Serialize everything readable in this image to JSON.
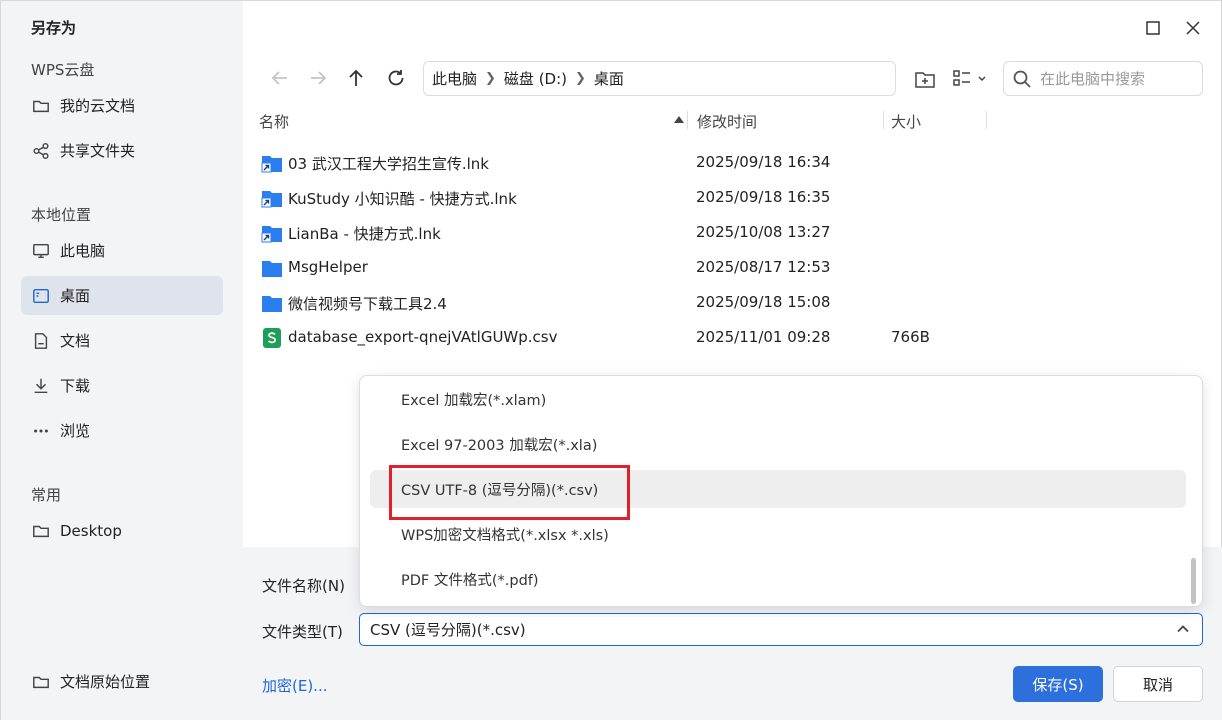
{
  "window": {
    "title": "另存为"
  },
  "sidebar": {
    "sections": [
      {
        "label": "WPS云盘"
      },
      {
        "label": "本地位置"
      },
      {
        "label": "常用"
      }
    ],
    "cloud_items": [
      {
        "label": "我的云文档",
        "icon": "folder-icon"
      },
      {
        "label": "共享文件夹",
        "icon": "share-icon"
      }
    ],
    "local_items": [
      {
        "label": "此电脑",
        "icon": "monitor-icon"
      },
      {
        "label": "桌面",
        "icon": "desktop-icon",
        "active": true
      },
      {
        "label": "文档",
        "icon": "document-icon"
      },
      {
        "label": "下载",
        "icon": "download-icon"
      },
      {
        "label": "浏览",
        "icon": "more-icon"
      }
    ],
    "common_items": [
      {
        "label": "Desktop",
        "icon": "folder-icon"
      }
    ],
    "bottom_item": {
      "label": "文档原始位置",
      "icon": "folder-icon"
    }
  },
  "breadcrumb": [
    "此电脑",
    "磁盘 (D:)",
    "桌面"
  ],
  "search": {
    "placeholder": "在此电脑中搜索"
  },
  "columns": {
    "name": "名称",
    "modified": "修改时间",
    "size": "大小"
  },
  "files": [
    {
      "name": "03 武汉工程大学招生宣传.lnk",
      "modified": "2025/09/18 16:34",
      "size": "",
      "icon": "shortcut-folder-icon"
    },
    {
      "name": "KuStudy 小知识酷 - 快捷方式.lnk",
      "modified": "2025/09/18 16:35",
      "size": "",
      "icon": "shortcut-folder-icon"
    },
    {
      "name": "LianBa - 快捷方式.lnk",
      "modified": "2025/10/08 13:27",
      "size": "",
      "icon": "shortcut-folder-icon"
    },
    {
      "name": "MsgHelper",
      "modified": "2025/08/17 12:53",
      "size": "",
      "icon": "folder-icon"
    },
    {
      "name": "微信视频号下载工具2.4",
      "modified": "2025/09/18 15:08",
      "size": "",
      "icon": "folder-icon"
    },
    {
      "name": "database_export-qnejVAtlGUWp.csv",
      "modified": "2025/11/01 09:28",
      "size": "766B",
      "icon": "spreadsheet-icon"
    }
  ],
  "form": {
    "filename_label": "文件名称(N)",
    "filetype_label": "文件类型(T)",
    "filetype_value": "CSV (逗号分隔)(*.csv)"
  },
  "dropdown_options": [
    "Excel 加载宏(*.xlam)",
    "Excel 97-2003 加载宏(*.xla)",
    "CSV UTF-8 (逗号分隔)(*.csv)",
    "WPS加密文档格式(*.xlsx *.xls)",
    "PDF 文件格式(*.pdf)"
  ],
  "highlighted_option_index": 2,
  "buttons": {
    "encrypt": "加密(E)...",
    "save": "保存(S)",
    "cancel": "取消"
  },
  "colors": {
    "accent": "#2c6fdd",
    "highlight_border": "#e0202a",
    "folder": "#2b7ef0",
    "spreadsheet": "#1e9e57"
  }
}
